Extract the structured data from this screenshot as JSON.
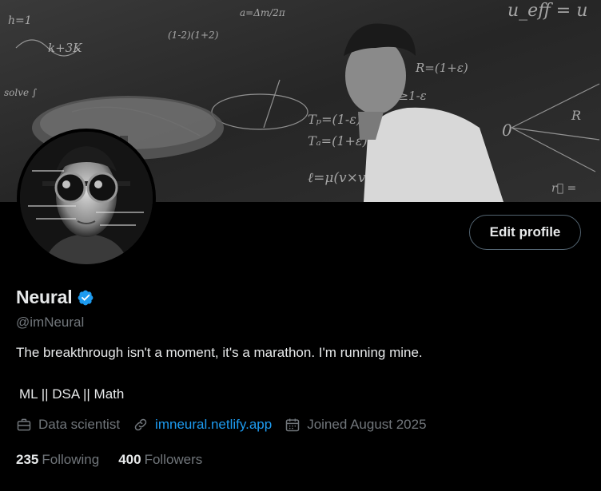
{
  "banner": {
    "equations": [
      "x≥1-ε",
      "Tₐ=(1+ε)a",
      "Tₚ=(1-ε)a",
      "ℓ=μ(v×v)sinθ",
      "R=(1+ε)",
      "u_eff = u",
      "0",
      "R",
      "k+3K",
      "(1-2)"
    ]
  },
  "profile": {
    "name": "Neural",
    "handle": "@imNeural",
    "bio": "The breakthrough isn't a moment, it's a marathon. I'm running mine.",
    "tags": "ML || DSA || Math",
    "edit_button": "Edit profile"
  },
  "meta": {
    "profession": "Data scientist",
    "website": "imneural.netlify.app",
    "joined": "Joined August 2025"
  },
  "stats": {
    "following_count": "235",
    "following_label": "Following",
    "followers_count": "400",
    "followers_label": "Followers"
  },
  "icons": {
    "verified": "verified-badge-icon",
    "profession": "briefcase-icon",
    "website": "link-icon",
    "joined": "calendar-icon"
  },
  "colors": {
    "background": "#000000",
    "text": "#e7e9ea",
    "muted": "#71767b",
    "accent": "#1d9bf0",
    "border": "#536471"
  }
}
